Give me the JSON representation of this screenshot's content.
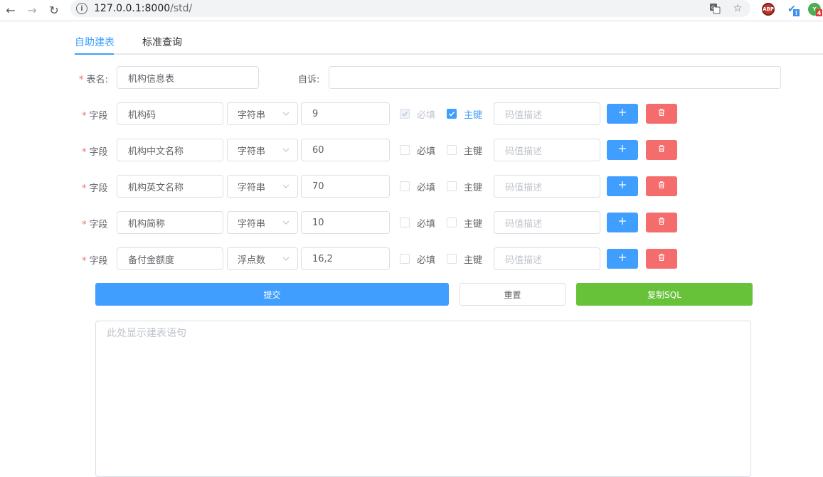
{
  "browser": {
    "url_host": "127.0.0.1:8000",
    "url_path": "/std/",
    "ext_abp_label": "ABP",
    "ext_bird_badge": "!",
    "ext_green_label": "Y",
    "ext_green_badge": "4"
  },
  "tabs": [
    {
      "label": "自助建表",
      "active": true
    },
    {
      "label": "标准查询",
      "active": false
    }
  ],
  "form": {
    "table_name_label": "表名:",
    "table_name_value": "机构信息表",
    "comment_label": "自诉:",
    "comment_value": "",
    "required_mark": "*",
    "field_label": "字段",
    "required_checkbox_label": "必填",
    "primary_key_label": "主键",
    "code_desc_placeholder": "码值描述",
    "fields": [
      {
        "name": "机构码",
        "type": "字符串",
        "length": "9",
        "required": true,
        "required_disabled": true,
        "primary_key": true
      },
      {
        "name": "机构中文名称",
        "type": "字符串",
        "length": "60",
        "required": false,
        "required_disabled": false,
        "primary_key": false
      },
      {
        "name": "机构英文名称",
        "type": "字符串",
        "length": "70",
        "required": false,
        "required_disabled": false,
        "primary_key": false
      },
      {
        "name": "机构简称",
        "type": "字符串",
        "length": "10",
        "required": false,
        "required_disabled": false,
        "primary_key": false
      },
      {
        "name": "备付金额度",
        "type": "浮点数",
        "length": "16,2",
        "required": false,
        "required_disabled": false,
        "primary_key": false
      }
    ]
  },
  "actions": {
    "submit_label": "提交",
    "reset_label": "重置",
    "copy_sql_label": "复制SQL"
  },
  "output": {
    "placeholder": "此处显示建表语句"
  },
  "colors": {
    "primary": "#409eff",
    "danger": "#f56c6c",
    "success": "#67c23a"
  }
}
